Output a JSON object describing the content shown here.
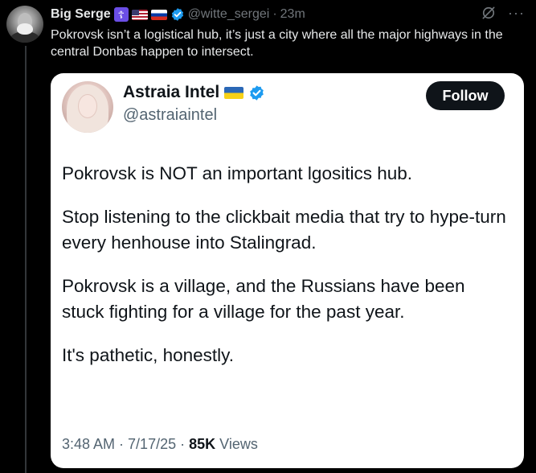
{
  "outer_post": {
    "author_name": "Big Serge",
    "badge_icons": [
      "orthodox-cross-flag-icon",
      "us-flag-icon",
      "russia-flag-icon",
      "verified-badge-icon"
    ],
    "handle": "@witte_sergei",
    "separator": "·",
    "time": "23m",
    "text": "Pokrovsk isn’t a logistical hub, it’s just a city where all the major highways in the central Donbas happen to intersect.",
    "more_icon": "···",
    "colors": {
      "verified": "#1d9bf0",
      "cross_flag": "#6b4ee6"
    }
  },
  "quoted_post": {
    "author_name": "Astraia Intel",
    "badge_icons": [
      "ukraine-flag-icon",
      "verified-badge-icon"
    ],
    "handle": "@astraiaintel",
    "follow_label": "Follow",
    "paragraphs": [
      "Pokrovsk is NOT an important lgositics hub.",
      "Stop listening to the clickbait media that try to hype-turn every henhouse into Stalingrad.",
      "Pokrovsk is a village, and the Russians have been stuck fighting for a village for the past year.",
      "It's pathetic, honestly."
    ],
    "time": "3:48 AM",
    "sep1": "·",
    "date": "7/17/25",
    "sep2": "·",
    "views_count": "85K",
    "views_label": "Views"
  }
}
